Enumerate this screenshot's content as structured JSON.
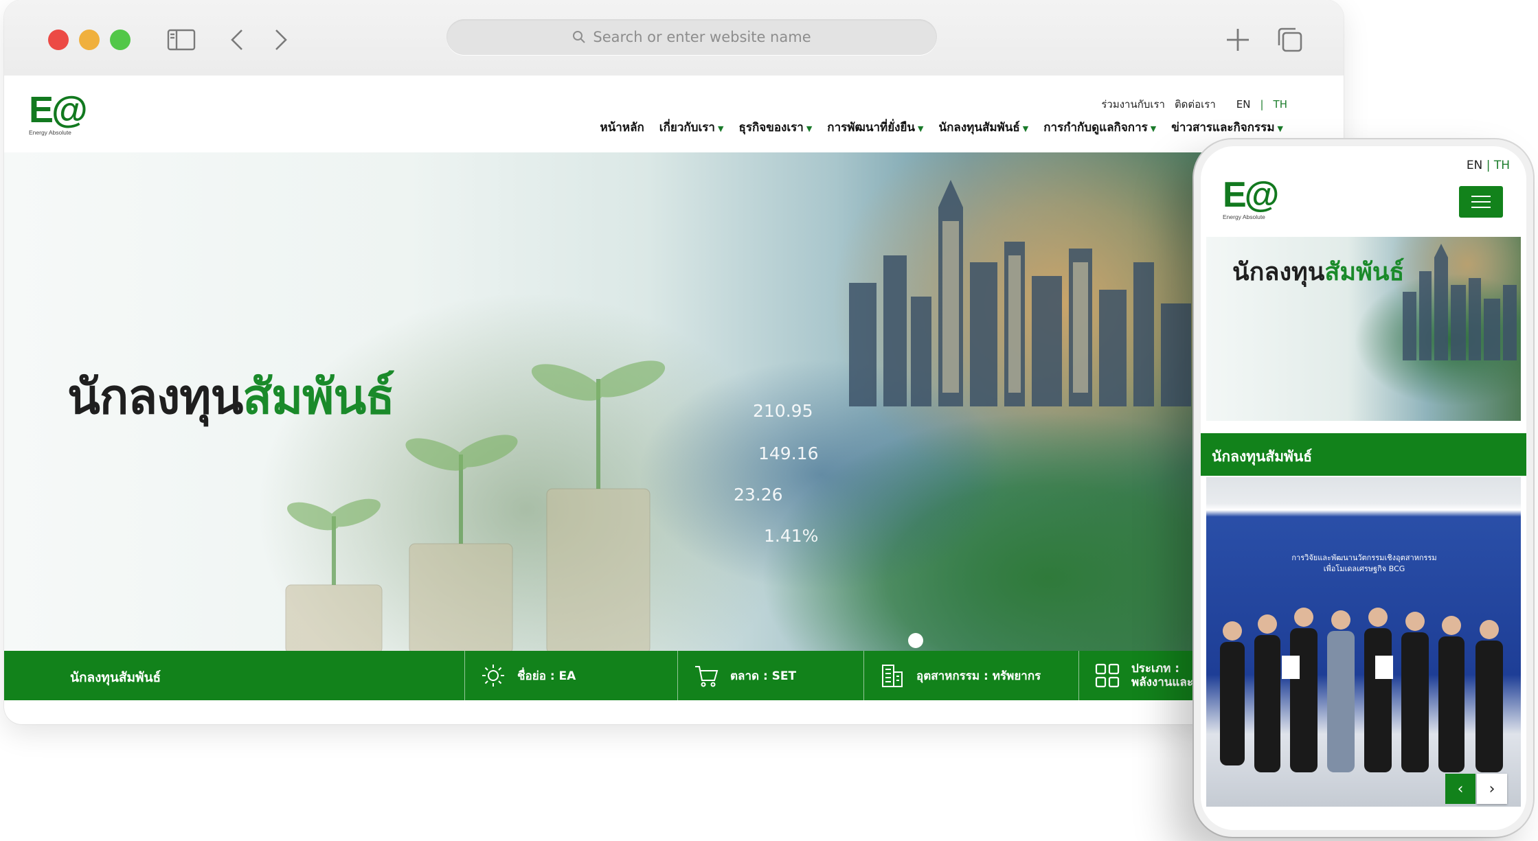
{
  "browser": {
    "search_placeholder": "Search or enter website name"
  },
  "site": {
    "logo_text": "E@",
    "logo_subtitle": "Energy Absolute",
    "util_links": [
      "ร่วมงานกับเรา",
      "ติดต่อเรา"
    ],
    "lang": {
      "en": "EN",
      "sep": "|",
      "th": "TH"
    },
    "nav": [
      {
        "label": "หน้าหลัก",
        "dropdown": false
      },
      {
        "label": "เกี่ยวกับเรา",
        "dropdown": true
      },
      {
        "label": "ธุรกิจของเรา",
        "dropdown": true
      },
      {
        "label": "การพัฒนาที่ยั่งยืน",
        "dropdown": true
      },
      {
        "label": "นักลงทุนสัมพันธ์",
        "dropdown": true
      },
      {
        "label": "การกำกับดูแลกิจการ",
        "dropdown": true
      },
      {
        "label": "ข่าวสารและกิจกรรม",
        "dropdown": true
      }
    ],
    "hero": {
      "title_part1": "นักลงทุน",
      "title_part2": "สัมพันธ์",
      "stats": [
        "210.95",
        "149.16",
        "23.26",
        "1.41%"
      ]
    },
    "infobar": {
      "title": "นักลงทุนสัมพันธ์",
      "items": [
        {
          "icon": "sun-icon",
          "label": "ชื่อย่อ : EA"
        },
        {
          "icon": "cart-icon",
          "label": "ตลาด : SET"
        },
        {
          "icon": "building-icon",
          "label": "อุตสาหกรรม : ทรัพยากร"
        },
        {
          "icon": "grid-icon",
          "label_line1": "ประเภท :",
          "label_line2": "พลังงานและ"
        }
      ]
    }
  },
  "phone": {
    "lang": {
      "en": "EN",
      "sep": "|",
      "th": "TH"
    },
    "logo_text": "E@",
    "logo_subtitle": "Energy Absolute",
    "hero_title_part1": "นักลงทุน",
    "hero_title_part2": "สัมพันธ์",
    "section_title": "นักลงทุนสัมพันธ์",
    "banner_line1": "การวิจัยและพัฒนานวัตกรรมเชิงอุตสาหกรรม",
    "banner_line2": "เพื่อโมเดลเศรษฐกิจ BCG"
  },
  "colors": {
    "brand_green": "#12821b",
    "accent_green": "#1a8a2a"
  }
}
